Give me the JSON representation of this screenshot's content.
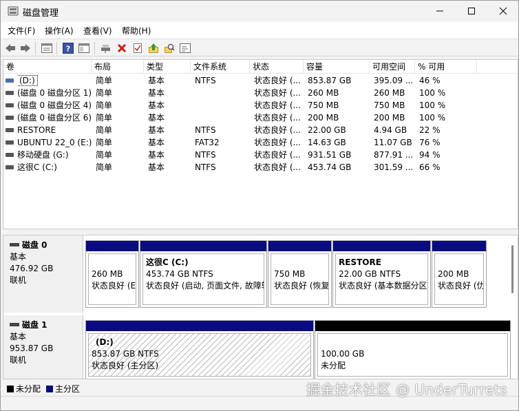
{
  "window": {
    "title": "磁盘管理"
  },
  "menu": [
    "文件(F)",
    "操作(A)",
    "查看(V)",
    "帮助(H)"
  ],
  "toolbar": {
    "buttons": [
      "back-icon",
      "forward-icon",
      "list-view-icon",
      "help-icon",
      "panel-icon",
      "connect-icon",
      "delete-icon",
      "properties-icon",
      "upload-icon",
      "search-icon",
      "settings-icon"
    ]
  },
  "volumes": {
    "headers": [
      "卷",
      "布局",
      "类型",
      "文件系统",
      "状态",
      "容量",
      "可用空间",
      "% 可用"
    ],
    "rows": [
      {
        "name": "(D:)",
        "layout": "简单",
        "type": "基本",
        "fs": "NTFS",
        "status": "状态良好 (...",
        "capacity": "853.87 GB",
        "free": "395.09 ...",
        "pct": "46 %"
      },
      {
        "name": "(磁盘 0 磁盘分区 1)",
        "layout": "简单",
        "type": "基本",
        "fs": "",
        "status": "状态良好 (...",
        "capacity": "260 MB",
        "free": "260 MB",
        "pct": "100 %"
      },
      {
        "name": "(磁盘 0 磁盘分区 4)",
        "layout": "简单",
        "type": "基本",
        "fs": "",
        "status": "状态良好 (...",
        "capacity": "750 MB",
        "free": "750 MB",
        "pct": "100 %"
      },
      {
        "name": "(磁盘 0 磁盘分区 6)",
        "layout": "简单",
        "type": "基本",
        "fs": "",
        "status": "状态良好 (...",
        "capacity": "200 MB",
        "free": "200 MB",
        "pct": "100 %"
      },
      {
        "name": "RESTORE",
        "layout": "简单",
        "type": "基本",
        "fs": "NTFS",
        "status": "状态良好 (...",
        "capacity": "22.00 GB",
        "free": "4.94 GB",
        "pct": "22 %"
      },
      {
        "name": "UBUNTU 22_0 (E:)",
        "layout": "简单",
        "type": "基本",
        "fs": "FAT32",
        "status": "状态良好 (...",
        "capacity": "14.63 GB",
        "free": "11.07 GB",
        "pct": "76 %"
      },
      {
        "name": "移动硬盘 (G:)",
        "layout": "简单",
        "type": "基本",
        "fs": "NTFS",
        "status": "状态良好 (...",
        "capacity": "931.51 GB",
        "free": "877.91 ...",
        "pct": "94 %"
      },
      {
        "name": "这很C (C:)",
        "layout": "简单",
        "type": "基本",
        "fs": "NTFS",
        "status": "状态良好 (...",
        "capacity": "453.74 GB",
        "free": "301.59 ...",
        "pct": "66 %"
      }
    ]
  },
  "disks": [
    {
      "name": "磁盘 0",
      "kind": "基本",
      "size": "476.92 GB",
      "state": "联机",
      "partitions": [
        {
          "title": "",
          "size": "260 MB",
          "status": "状态良好 (E"
        },
        {
          "title": "这很C  (C:)",
          "size": "453.74 GB NTFS",
          "status": "状态良好 (启动, 页面文件, 故障转"
        },
        {
          "title": "",
          "size": "750 MB",
          "status": "状态良好 (恢复"
        },
        {
          "title": "RESTORE",
          "size": "22.00 GB NTFS",
          "status": "状态良好 (基本数据分区"
        },
        {
          "title": "",
          "size": "200 MB",
          "status": "状态良好 (仂"
        }
      ]
    },
    {
      "name": "磁盘 1",
      "kind": "基本",
      "size": "953.87 GB",
      "state": "联机",
      "partitions": [
        {
          "title": "(D:)",
          "size": "853.87 GB NTFS",
          "status": "状态良好 (主分区)"
        },
        {
          "title": "",
          "size": "100.00 GB",
          "status": "未分配"
        }
      ]
    }
  ],
  "legend": {
    "unallocated": "未分配",
    "primary": "主分区",
    "unallocated_color": "#000000",
    "primary_color": "#0a0a82"
  },
  "watermark": "掘金技术社区 @ UnderTurrets"
}
